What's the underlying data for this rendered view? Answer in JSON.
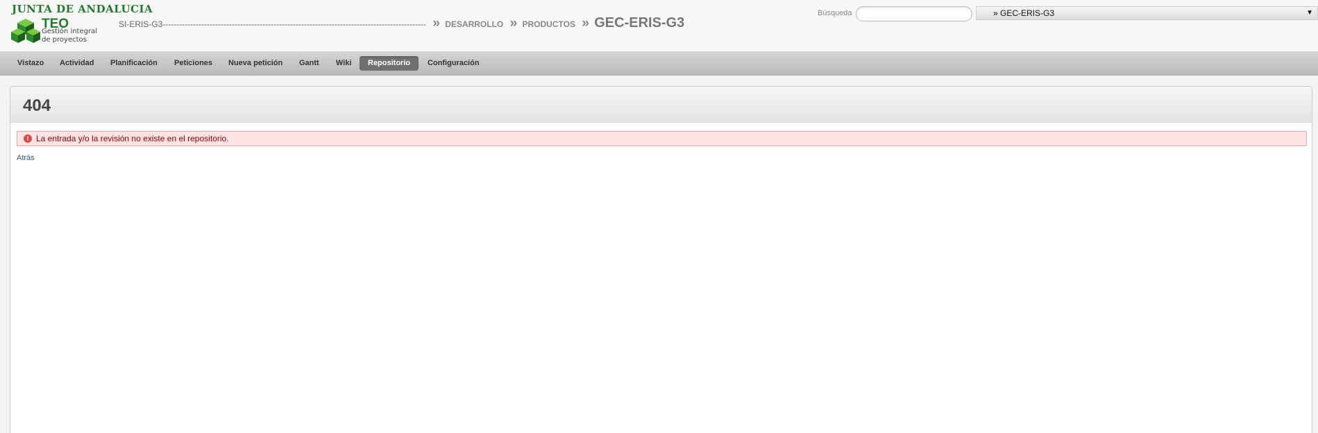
{
  "header": {
    "logo_junta": "JUNTA DE ANDALUCIA",
    "logo_teo": "TEO",
    "logo_subtitle": "Gestión integral de proyectos",
    "breadcrumb": {
      "root": "SI-ERIS-G3-----------------------------------------------------------------------------------------------",
      "items": [
        "DESARROLLO",
        "PRODUCTOS"
      ],
      "separator": "»",
      "current": "GEC-ERIS-G3"
    },
    "search_label": "Búsqueda",
    "search_value": "",
    "project_jump": "» GEC-ERIS-G3",
    "colors": {
      "brand_green": "#1f7a2a"
    }
  },
  "menu": {
    "items": [
      "Vistazo",
      "Actividad",
      "Planificación",
      "Peticiones",
      "Nueva petición",
      "Gantt",
      "Wiki",
      "Repositorio",
      "Configuración"
    ],
    "selected": "Repositorio"
  },
  "content": {
    "title": "404",
    "error_message": "La entrada y/o la revisión no existe en el repositorio.",
    "back_link": "Atrás",
    "error_icon": "!"
  }
}
